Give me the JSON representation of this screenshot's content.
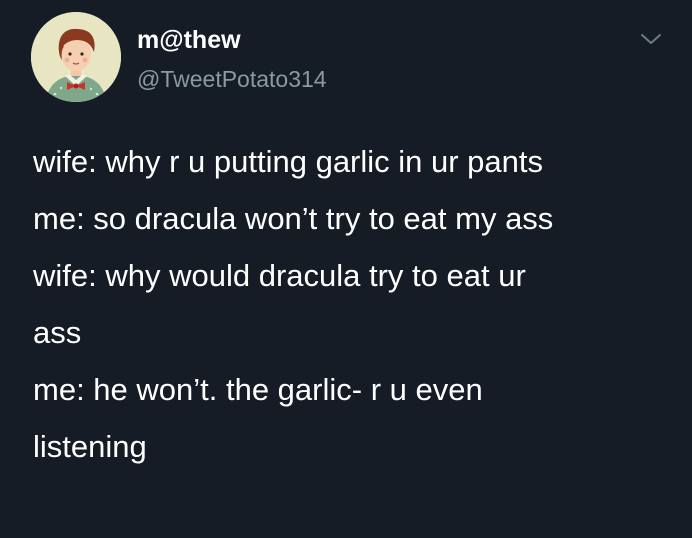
{
  "tweet": {
    "display_name": "m@thew",
    "handle": "@TweetPotato314",
    "text_lines": [
      "wife: why r u putting garlic in ur pants",
      "me: so dracula won’t try to eat my ass",
      "wife: why would dracula try to eat ur",
      "ass",
      "me: he won’t. the garlic- r u even",
      "listening"
    ]
  },
  "icons": {
    "avatar": "avatar-illustration",
    "menu": "chevron-down-icon"
  },
  "colors": {
    "background": "#151c26",
    "primary_text": "#ffffff",
    "secondary_text": "#8b98a5"
  }
}
